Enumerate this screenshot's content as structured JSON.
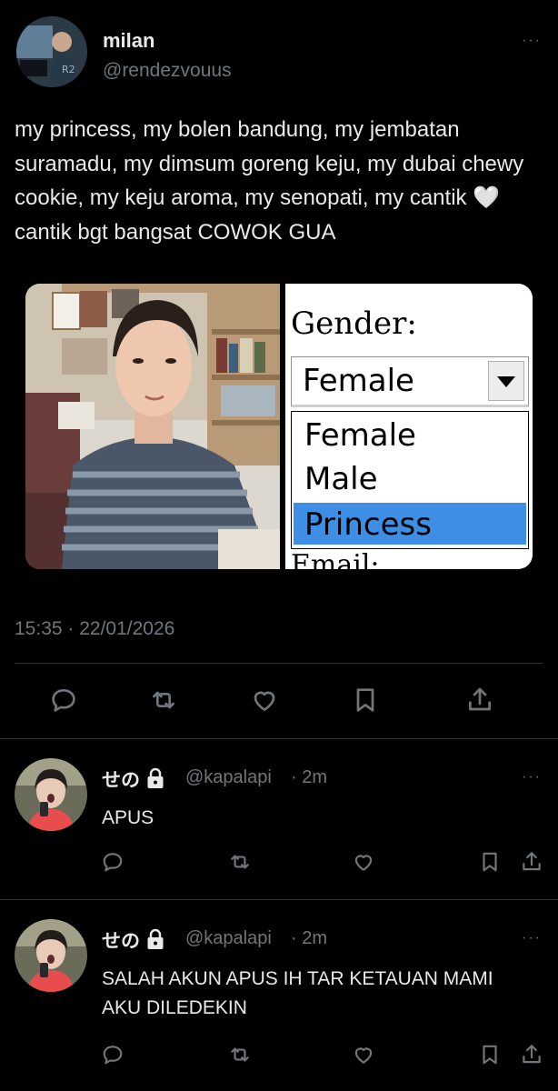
{
  "tweet": {
    "author_name": "milan",
    "author_handle": "@rendezvouus",
    "more": "···",
    "text": "my princess, my bolen bandung, my jembatan suramadu, my dimsum goreng keju, my dubai chewy cookie, my keju aroma, my senopati, my cantik 🤍 cantik bgt bangsat COWOK GUA",
    "timestamp": "15:35 · 22/01/2026",
    "meme": {
      "label": "Gender:",
      "selected": "Female",
      "options": [
        "Female",
        "Male",
        "Princess"
      ],
      "next_label": "Email:"
    },
    "actions": [
      "reply-icon",
      "retweet-icon",
      "like-icon",
      "bookmark-icon",
      "share-icon"
    ]
  },
  "replies": [
    {
      "name": "せの",
      "handle": "@kapalapi",
      "time": "· 2m",
      "text": "APUS",
      "more": "···"
    },
    {
      "name": "せの",
      "handle": "@kapalapi",
      "time": "· 2m",
      "text": "SALAH AKUN APUS IH TAR KETAUAN MAMI AKU DILEDEKIN",
      "more": "···"
    }
  ]
}
